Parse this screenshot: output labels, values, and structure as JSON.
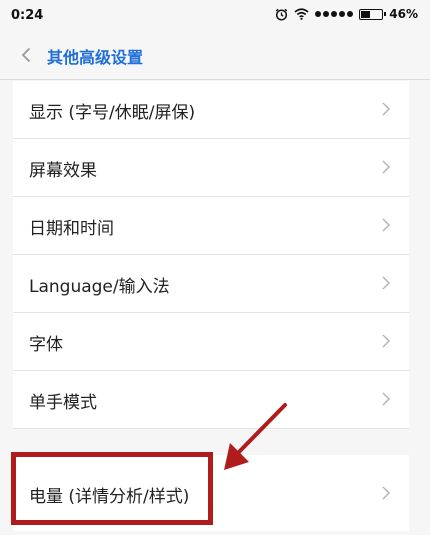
{
  "status_bar": {
    "time": "0:24",
    "battery_percent": "46%",
    "battery_level": 0.46,
    "icons": [
      "alarm-icon",
      "wifi-icon",
      "signal-dots-icon",
      "battery-icon"
    ]
  },
  "header": {
    "title": "其他高级设置",
    "back_icon": "chevron-left-icon",
    "accent_color": "#1f6fd6"
  },
  "settings": {
    "items": [
      {
        "label": "显示 (字号/休眠/屏保)"
      },
      {
        "label": "屏幕效果"
      },
      {
        "label": "日期和时间"
      },
      {
        "label": "Language/输入法"
      },
      {
        "label": "字体"
      },
      {
        "label": "单手模式"
      },
      {
        "label": "电量 (详情分析/样式)"
      }
    ]
  },
  "annotation": {
    "highlight_color": "#b01b1b",
    "highlighted_item": "电量 (详情分析/样式)"
  }
}
